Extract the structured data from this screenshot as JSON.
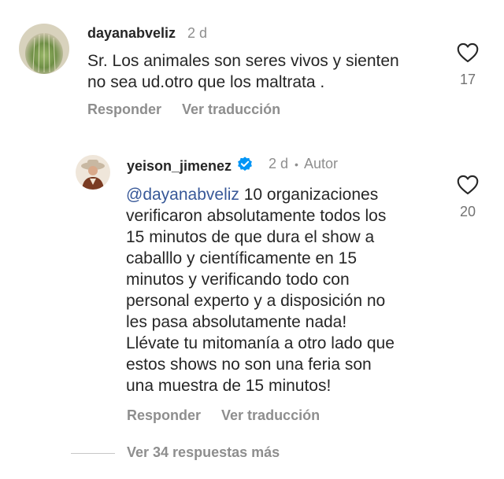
{
  "comments": [
    {
      "username": "dayanabveliz",
      "time": "2 d",
      "text": "Sr. Los animales son seres vivos y sienten\nno sea ud.otro que los maltrata .",
      "likes": "17",
      "reply_label": "Responder",
      "translate_label": "Ver traducción"
    },
    {
      "username": "yeison_jimenez",
      "time": "2 d",
      "separator": "•",
      "author_label": "Autor",
      "mention": "@dayanabveliz",
      "text": " 10 organizaciones\nverificaron absolutamente todos los\n15 minutos de que dura el show a\ncaballlo y científicamente en 15\nminutos y verificando todo con\npersonal experto y a disposición no\nles pasa absolutamente nada!\nLlévate tu mitomanía a otro lado que\nestos shows no son una feria son\nuna muestra de 15 minutos!",
      "likes": "20",
      "reply_label": "Responder",
      "translate_label": "Ver traducción"
    }
  ],
  "more_replies_label": "Ver 34 respuestas más",
  "colors": {
    "text": "#262626",
    "secondary": "#8e8e8e",
    "mention": "#385898",
    "verified": "#0095f6"
  }
}
